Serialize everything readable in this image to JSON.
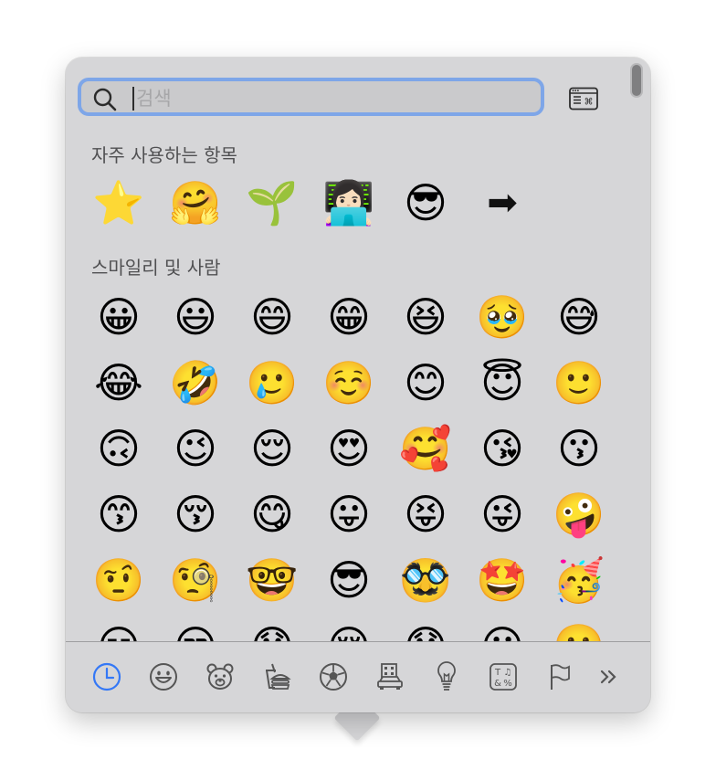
{
  "search": {
    "placeholder": "검색",
    "value": ""
  },
  "sections": [
    {
      "title": "자주 사용하는 항목",
      "emojis": [
        "⭐",
        "🤗",
        "🌱",
        "👩🏻‍💻",
        "😎",
        "➡"
      ]
    },
    {
      "title": "스마일리 및 사람",
      "emojis": [
        "😀",
        "😃",
        "😄",
        "😁",
        "😆",
        "🥹",
        "😅",
        "😂",
        "🤣",
        "🥲",
        "☺️",
        "😊",
        "😇",
        "🙂",
        "🙃",
        "😉",
        "😌",
        "😍",
        "🥰",
        "😘",
        "😗",
        "😙",
        "😚",
        "😋",
        "😛",
        "😝",
        "😜",
        "🤪",
        "🤨",
        "🧐",
        "🤓",
        "😎",
        "🥸",
        "🤩",
        "🥳",
        "😏",
        "😒",
        "😞",
        "😔",
        "😟",
        "😕",
        "🙁"
      ]
    }
  ],
  "categories": [
    {
      "icon": "clock-icon",
      "label": "Frequently Used",
      "selected": true
    },
    {
      "icon": "smiley-icon",
      "label": "Smileys & People"
    },
    {
      "icon": "bear-icon",
      "label": "Animals & Nature"
    },
    {
      "icon": "food-icon",
      "label": "Food & Drink"
    },
    {
      "icon": "soccer-ball-icon",
      "label": "Activity"
    },
    {
      "icon": "building-car-icon",
      "label": "Travel & Places"
    },
    {
      "icon": "lightbulb-icon",
      "label": "Objects"
    },
    {
      "icon": "symbols-icon",
      "label": "Symbols"
    },
    {
      "icon": "flag-icon",
      "label": "Flags"
    },
    {
      "icon": "chevron-double-right-icon",
      "label": "More"
    }
  ],
  "colors": {
    "accent": "#3478f6",
    "panel": "#d6d6d8",
    "focus_ring": "#7ea6e8"
  }
}
